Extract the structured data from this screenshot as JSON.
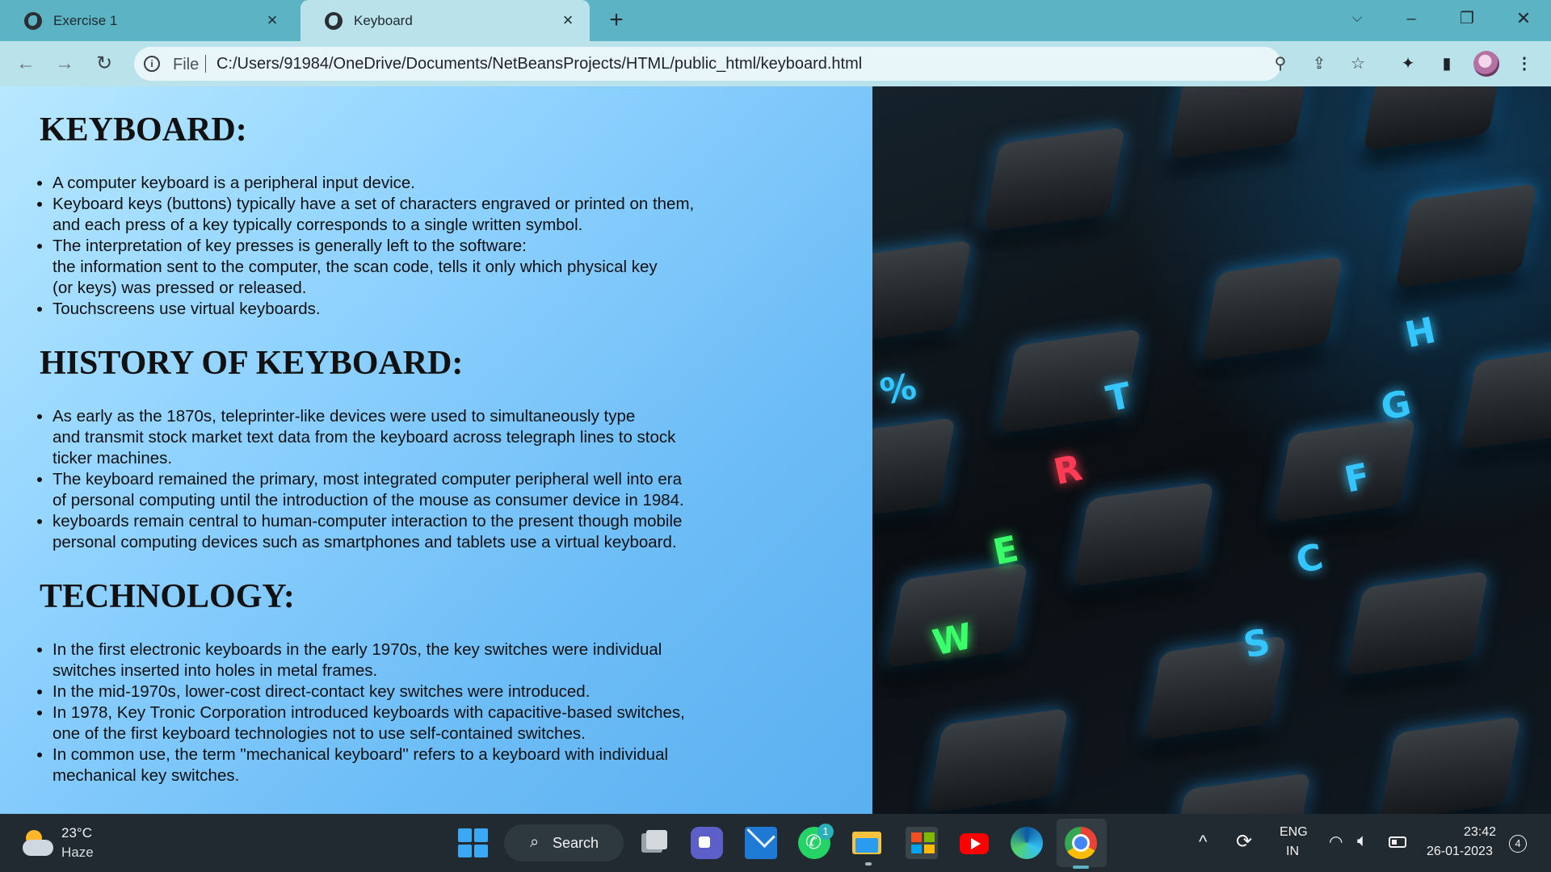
{
  "browser": {
    "tabs": [
      {
        "label": "Exercise 1",
        "active": false
      },
      {
        "label": "Keyboard",
        "active": true
      }
    ],
    "new_tab_icon": "plus-icon",
    "address_bar": {
      "scheme_label": "File",
      "url": "C:/Users/91984/OneDrive/Documents/NetBeansProjects/HTML/public_html/keyboard.html"
    },
    "colors": {
      "tabstrip": "#5cb3c4",
      "toolbar": "#b9e2ea"
    }
  },
  "page": {
    "sections": [
      {
        "heading": "KEYBOARD:",
        "items": [
          "A computer keyboard is a peripheral input device.",
          "Keyboard keys (buttons) typically have a set of characters engraved or printed on them,\nand each press of a key typically corresponds to a single written symbol.",
          "The interpretation of key presses is generally left to the software:\nthe information sent to the computer, the scan code, tells it only which physical key\n(or keys) was pressed or released.",
          "Touchscreens use virtual keyboards."
        ]
      },
      {
        "heading": "HISTORY OF KEYBOARD:",
        "items": [
          "As early as the 1870s, teleprinter-like devices were used to simultaneously type\nand transmit stock market text data from the keyboard across telegraph lines to stock\nticker machines.",
          "The keyboard remained the primary, most integrated computer peripheral well into era\nof personal computing until the introduction of the mouse as consumer device in 1984.",
          "keyboards remain central to human-computer interaction to the present though mobile\npersonal computing devices such as smartphones and tablets use a virtual keyboard."
        ]
      },
      {
        "heading": "TECHNOLOGY:",
        "items": [
          "In the first electronic keyboards in the early 1970s, the key switches were individual\nswitches inserted into holes in metal frames.",
          "In the mid-1970s, lower-cost direct-contact key switches were introduced.",
          "In 1978, Key Tronic Corporation introduced keyboards with capacitive-based switches,\none of the first keyboard technologies not to use self-contained switches.",
          "In common use, the term \"mechanical keyboard\" refers to a keyboard with individual\nmechanical key switches."
        ]
      }
    ],
    "background": "light blue gradient",
    "image": {
      "subject": "backlit mechanical keyboard",
      "key_legends": [
        "%",
        "T",
        "H",
        "G",
        "R",
        "F",
        "E",
        "C",
        "S",
        "W"
      ]
    }
  },
  "taskbar": {
    "weather": {
      "temperature": "23°C",
      "condition": "Haze"
    },
    "search_label": "Search",
    "whatsapp_badge": "1",
    "language": {
      "line1": "ENG",
      "line2": "IN"
    },
    "clock": {
      "time": "23:42",
      "date": "26-01-2023"
    },
    "notification_count": "4",
    "colors": {
      "background": "#202a30"
    }
  }
}
